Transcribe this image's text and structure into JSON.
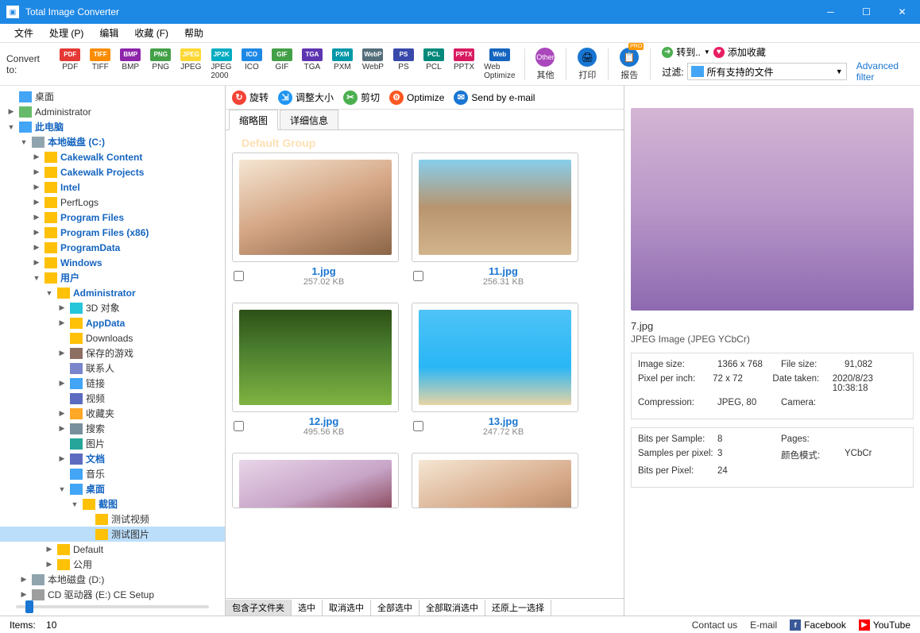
{
  "titlebar": {
    "title": "Total Image Converter"
  },
  "menu": {
    "items": [
      "文件",
      "处理 (P)",
      "编辑",
      "收藏 (F)",
      "帮助"
    ]
  },
  "toolbar": {
    "convert_label": "Convert to:",
    "formats": [
      {
        "id": "PDF",
        "c": "#e53935"
      },
      {
        "id": "TIFF",
        "c": "#fb8c00"
      },
      {
        "id": "BMP",
        "c": "#8e24aa"
      },
      {
        "id": "PNG",
        "c": "#43a047"
      },
      {
        "id": "JPEG",
        "c": "#fdd835"
      },
      {
        "id": "JPEG 2000",
        "badge": "JP2K",
        "c": "#00acc1"
      },
      {
        "id": "ICO",
        "c": "#1e88e5"
      },
      {
        "id": "GIF",
        "c": "#43a047"
      },
      {
        "id": "TGA",
        "c": "#5e35b1"
      },
      {
        "id": "PXM",
        "c": "#0097a7"
      },
      {
        "id": "WebP",
        "c": "#546e7a"
      },
      {
        "id": "PS",
        "c": "#3949ab"
      },
      {
        "id": "PCL",
        "c": "#00897b"
      },
      {
        "id": "PPTX",
        "c": "#d81b60"
      },
      {
        "id": "Web Optimize",
        "badge": "Web",
        "c": "#1565c0"
      }
    ],
    "other": "其他",
    "print": "打印",
    "report": "报告",
    "convert_to": "转到..",
    "add_fav": "添加收藏",
    "filter": "过滤:",
    "filter_value": "所有支持的文件",
    "adv_filter": "Advanced filter"
  },
  "tree": [
    {
      "lvl": 0,
      "caret": "",
      "icon": "pc",
      "label": "桌面",
      "emph": false
    },
    {
      "lvl": 0,
      "caret": "▶",
      "icon": "user",
      "label": "Administrator"
    },
    {
      "lvl": 0,
      "caret": "▼",
      "icon": "pc",
      "label": "此电脑",
      "emph": true
    },
    {
      "lvl": 1,
      "caret": "▼",
      "icon": "disk",
      "label": "本地磁盘 (C:)",
      "emph": true
    },
    {
      "lvl": 2,
      "caret": "▶",
      "icon": "folder",
      "label": "Cakewalk Content",
      "emph": true
    },
    {
      "lvl": 2,
      "caret": "▶",
      "icon": "folder",
      "label": "Cakewalk Projects",
      "emph": true
    },
    {
      "lvl": 2,
      "caret": "▶",
      "icon": "folder",
      "label": "Intel",
      "emph": true
    },
    {
      "lvl": 2,
      "caret": "▶",
      "icon": "folder",
      "label": "PerfLogs"
    },
    {
      "lvl": 2,
      "caret": "▶",
      "icon": "folder",
      "label": "Program Files",
      "emph": true
    },
    {
      "lvl": 2,
      "caret": "▶",
      "icon": "folder",
      "label": "Program Files (x86)",
      "emph": true
    },
    {
      "lvl": 2,
      "caret": "▶",
      "icon": "folder",
      "label": "ProgramData",
      "emph": true
    },
    {
      "lvl": 2,
      "caret": "▶",
      "icon": "folder",
      "label": "Windows",
      "emph": true
    },
    {
      "lvl": 2,
      "caret": "▼",
      "icon": "folder",
      "label": "用户",
      "emph": true
    },
    {
      "lvl": 3,
      "caret": "▼",
      "icon": "folder",
      "label": "Administrator",
      "emph": true
    },
    {
      "lvl": 4,
      "caret": "▶",
      "icon": "3d",
      "label": "3D 对象"
    },
    {
      "lvl": 4,
      "caret": "▶",
      "icon": "folder",
      "label": "AppData",
      "emph": true
    },
    {
      "lvl": 4,
      "caret": "",
      "icon": "folder",
      "label": "Downloads"
    },
    {
      "lvl": 4,
      "caret": "▶",
      "icon": "game",
      "label": "保存的游戏"
    },
    {
      "lvl": 4,
      "caret": "",
      "icon": "contact",
      "label": "联系人"
    },
    {
      "lvl": 4,
      "caret": "▶",
      "icon": "link",
      "label": "链接"
    },
    {
      "lvl": 4,
      "caret": "",
      "icon": "video",
      "label": "视频"
    },
    {
      "lvl": 4,
      "caret": "▶",
      "icon": "star",
      "label": "收藏夹"
    },
    {
      "lvl": 4,
      "caret": "▶",
      "icon": "search",
      "label": "搜索"
    },
    {
      "lvl": 4,
      "caret": "",
      "icon": "pic",
      "label": "图片"
    },
    {
      "lvl": 4,
      "caret": "▶",
      "icon": "doc",
      "label": "文档",
      "emph": true
    },
    {
      "lvl": 4,
      "caret": "",
      "icon": "music",
      "label": "音乐"
    },
    {
      "lvl": 4,
      "caret": "▼",
      "icon": "desk",
      "label": "桌面",
      "emph": true
    },
    {
      "lvl": 5,
      "caret": "▼",
      "icon": "folder",
      "label": "截图",
      "emph": true
    },
    {
      "lvl": 6,
      "caret": "",
      "icon": "folder",
      "label": "测试视频"
    },
    {
      "lvl": 6,
      "caret": "",
      "icon": "folder",
      "label": "测试图片",
      "sel": true
    },
    {
      "lvl": 3,
      "caret": "▶",
      "icon": "folder",
      "label": "Default"
    },
    {
      "lvl": 3,
      "caret": "▶",
      "icon": "folder",
      "label": "公用"
    },
    {
      "lvl": 1,
      "caret": "▶",
      "icon": "disk",
      "label": "本地磁盘 (D:)"
    },
    {
      "lvl": 1,
      "caret": "▶",
      "icon": "cd",
      "label": "CD 驱动器 (E:) CE Setup"
    }
  ],
  "actions": {
    "rotate": "旋转",
    "resize": "调整大小",
    "crop": "剪切",
    "optimize": "Optimize",
    "email": "Send by e-mail"
  },
  "viewtabs": {
    "thumb": "缩略图",
    "detail": "详细信息"
  },
  "group_label": "Default Group",
  "thumbs": [
    {
      "name": "1.jpg",
      "size": "257.02 KB",
      "img": "img1"
    },
    {
      "name": "11.jpg",
      "size": "256.31 KB",
      "img": "img11"
    },
    {
      "name": "12.jpg",
      "size": "495.56 KB",
      "img": "img12"
    },
    {
      "name": "13.jpg",
      "size": "247.72 KB",
      "img": "img13"
    },
    {
      "name": "",
      "size": "",
      "img": "img7",
      "partial": true
    },
    {
      "name": "",
      "size": "",
      "img": "img1",
      "partial": true
    }
  ],
  "bottombar": [
    "包含子文件夹",
    "选中",
    "取消选中",
    "全部选中",
    "全部取消选中",
    "还原上一选择"
  ],
  "preview": {
    "name": "7.jpg",
    "type": "JPEG Image (JPEG YCbCr)",
    "block1": [
      {
        "k": "Image size:",
        "v": "1366 x 768",
        "k2": "File size:",
        "v2": "91,082"
      },
      {
        "k": "Pixel per inch:",
        "v": "72 x 72",
        "k2": "Date taken:",
        "v2": "2020/8/23 10:38:18"
      },
      {
        "k": "Compression:",
        "v": "JPEG, 80",
        "k2": "Camera:",
        "v2": ""
      }
    ],
    "block2": [
      {
        "k": "Bits per Sample:",
        "v": "8",
        "k2": "Pages:",
        "v2": ""
      },
      {
        "k": "Samples per pixel:",
        "v": "3",
        "k2": "颜色模式:",
        "v2": "YCbCr"
      },
      {
        "k": "Bits per Pixel:",
        "v": "24",
        "k2": "",
        "v2": ""
      }
    ]
  },
  "status": {
    "items_label": "Items:",
    "items_count": "10",
    "contact": "Contact us",
    "email": "E-mail",
    "facebook": "Facebook",
    "youtube": "YouTube"
  }
}
